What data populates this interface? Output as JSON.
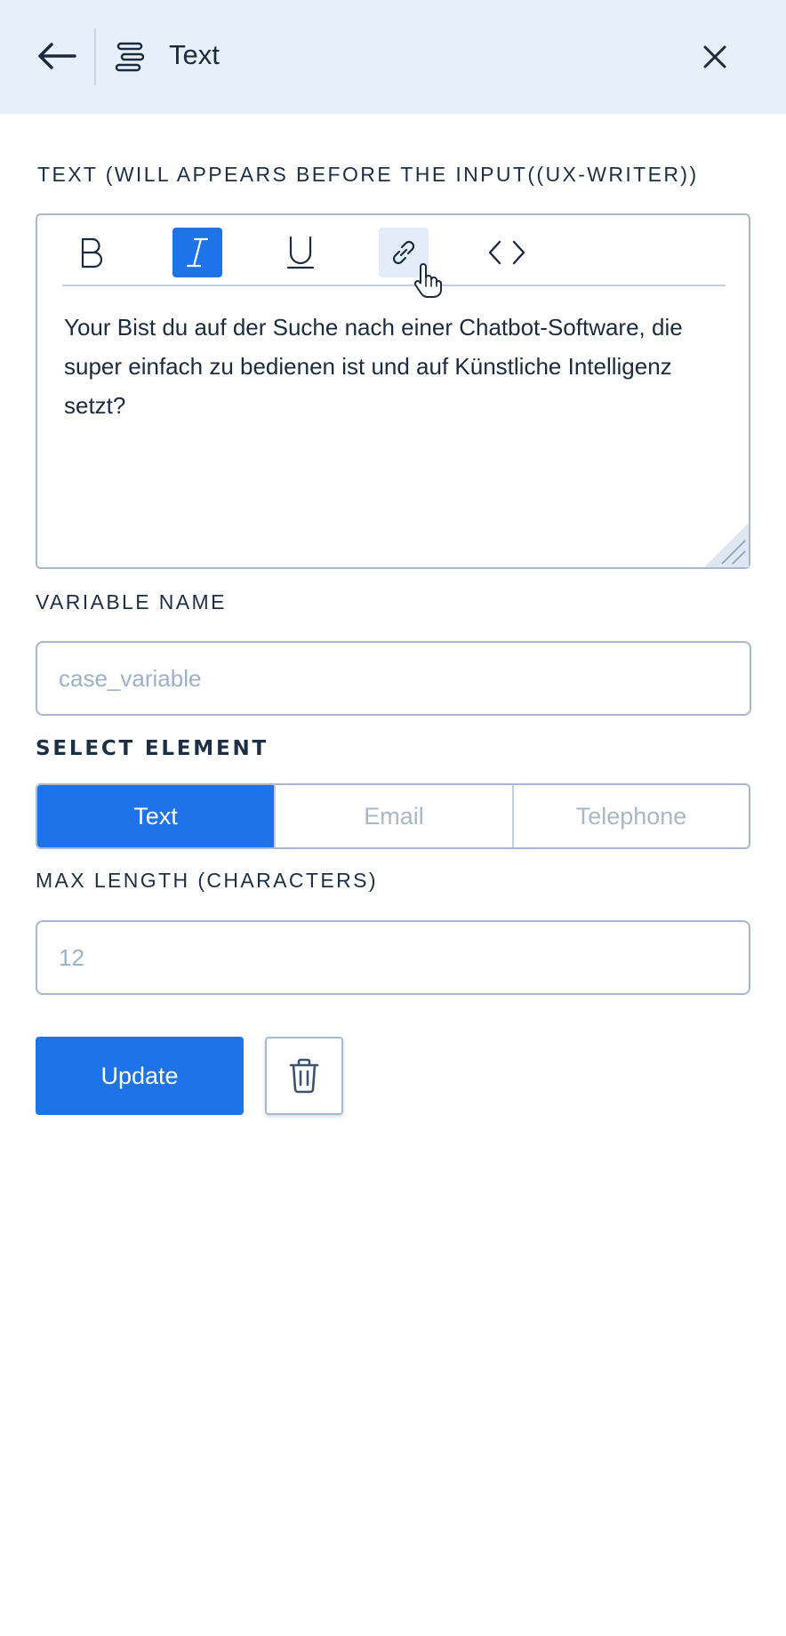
{
  "header": {
    "title": "Text",
    "back_icon": "arrow-left-icon",
    "title_icon": "text-align-icon",
    "close_icon": "close-icon"
  },
  "editor_section": {
    "label": "TEXT (WILL APPEARS BEFORE THE INPUT((UX-WRITER))",
    "toolbar": [
      "bold",
      "italic",
      "underline",
      "link",
      "code"
    ],
    "active_tool": "italic",
    "hovered_tool": "link",
    "content": "Your Bist du auf der Suche nach einer Chatbot-Software, die super einfach zu bedienen ist und auf Künstliche Intelligenz setzt?"
  },
  "variable_name": {
    "label": "VARIABLE NAME",
    "placeholder": "case_variable",
    "value": ""
  },
  "select_element": {
    "label": "SELECT ELEMENT",
    "options": [
      "Text",
      "Email",
      "Telephone"
    ],
    "selected": "Text"
  },
  "max_length": {
    "label": "MAX LENGTH (CHARACTERS)",
    "placeholder": "12",
    "value": ""
  },
  "actions": {
    "update_label": "Update",
    "delete_icon": "trash-icon"
  },
  "colors": {
    "accent": "#1e73e8",
    "header_bg": "#e6effa",
    "text": "#1b2c40",
    "border": "#a9b8cb"
  }
}
